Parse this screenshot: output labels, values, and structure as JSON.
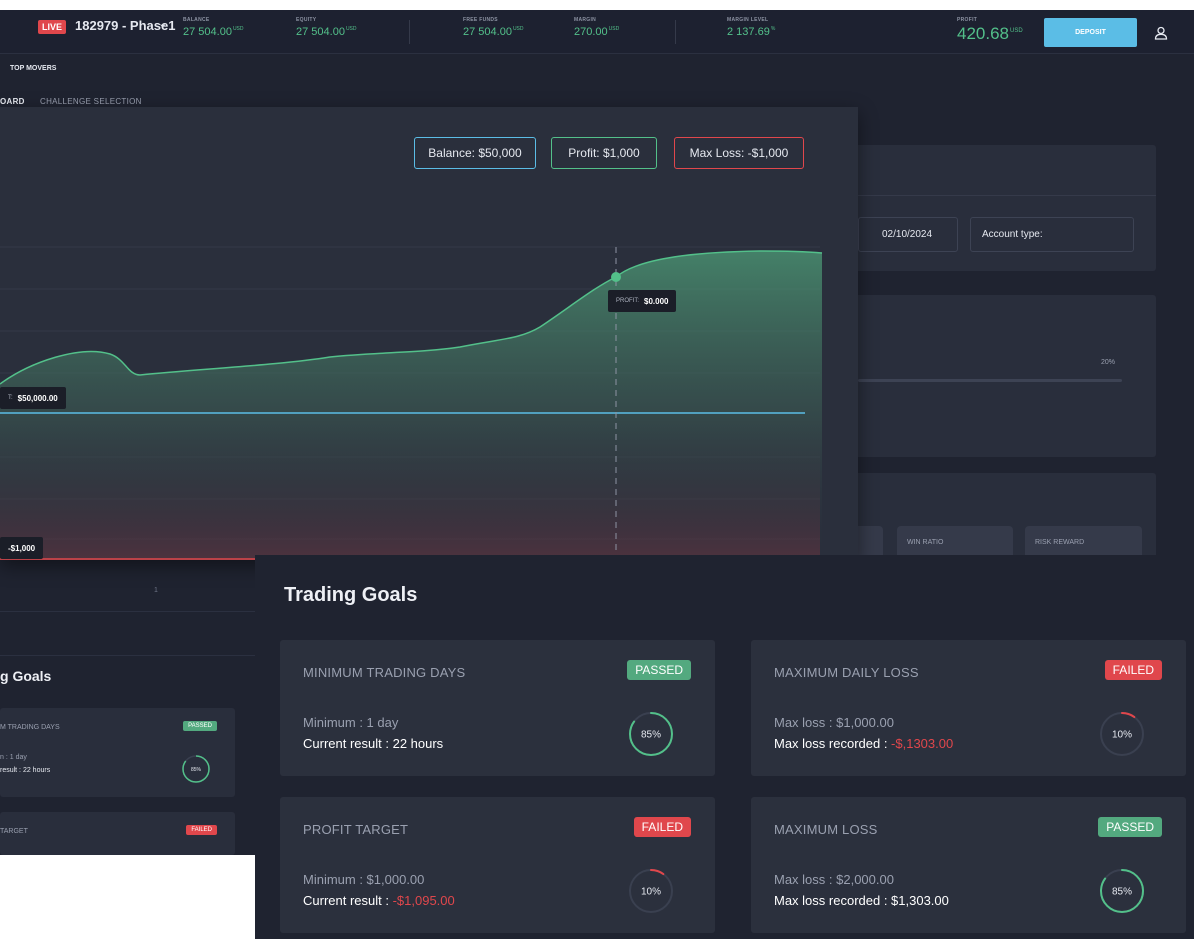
{
  "topbar": {
    "live_badge": "LIVE",
    "account_name": "182979 - Phase1",
    "metrics": [
      {
        "label": "BALANCE",
        "value": "27 504.00",
        "unit": "USD"
      },
      {
        "label": "EQUITY",
        "value": "27 504.00",
        "unit": "USD"
      },
      {
        "label": "FREE FUNDS",
        "value": "27 504.00",
        "unit": "USD"
      },
      {
        "label": "MARGIN",
        "value": "270.00",
        "unit": "USD"
      },
      {
        "label": "MARGIN LEVEL",
        "value": "2 137.69",
        "unit": "%"
      }
    ],
    "profit": {
      "label": "PROFIT",
      "value": "420.68",
      "unit": "USD"
    },
    "deposit_label": "DEPOSIT"
  },
  "nav": {
    "movers_tab": "TOP MOVERS",
    "tabs": [
      "OARD",
      "CHALLENGE SELECTION"
    ]
  },
  "account_info": {
    "date": "02/10/2024",
    "account_type_label": "Account type:"
  },
  "progress": {
    "label": "20%",
    "value": 0.2
  },
  "stat_tiles": [
    "WIN RATIO",
    "RISK REWARD"
  ],
  "chart": {
    "legend": {
      "balance": "Balance: $50,000",
      "profit": "Profit: $1,000",
      "max_loss": "Max Loss: -$1,000"
    },
    "tooltip_profit": {
      "label": "PROFIT:",
      "value": "$0.000"
    },
    "tooltip_balance": {
      "label": "T:",
      "value": "$50,000.00"
    },
    "tooltip_loss": {
      "value": "-$1,000"
    },
    "colors": {
      "area": "#53c08a",
      "balance_line": "#5bbde6",
      "loss_line": "#e0474c"
    }
  },
  "back_lower": {
    "page_number": "1",
    "title": "g Goals",
    "cards": [
      {
        "title": "M TRADING DAYS",
        "badge": "PASSED",
        "line1": "n : 1 day",
        "line2": "result : 22 hours",
        "percent": "85%",
        "fraction": 0.85,
        "status": "passed"
      },
      {
        "title": "TARGET",
        "badge": "FAILED",
        "status": "failed"
      }
    ]
  },
  "trading_goals": {
    "title": "Trading Goals",
    "goals": [
      {
        "title": "MINIMUM TRADING DAYS",
        "badge": "PASSED",
        "status": "passed",
        "line1": "Minimum : 1 day",
        "line2_label": "Current result : ",
        "line2_value": "22 hours",
        "percent": "85%",
        "fraction": 0.85
      },
      {
        "title": "MAXIMUM DAILY LOSS",
        "badge": "FAILED",
        "status": "failed",
        "line1": "Max loss : $1,000.00",
        "line2_label": "Max loss recorded : ",
        "line2_value": "-$,1303.00",
        "percent": "10%",
        "fraction": 0.1
      },
      {
        "title": "PROFIT TARGET",
        "badge": "FAILED",
        "status": "failed",
        "line1": "Minimum : $1,000.00",
        "line2_label": "Current result : ",
        "line2_value": "-$1,095.00",
        "percent": "10%",
        "fraction": 0.1
      },
      {
        "title": "MAXIMUM LOSS",
        "badge": "PASSED",
        "status": "passed",
        "line1": "Max loss : $2,000.00",
        "line2_label": "Max loss recorded : ",
        "line2_value": "$1,303.00",
        "percent": "85%",
        "fraction": 0.85
      }
    ]
  }
}
